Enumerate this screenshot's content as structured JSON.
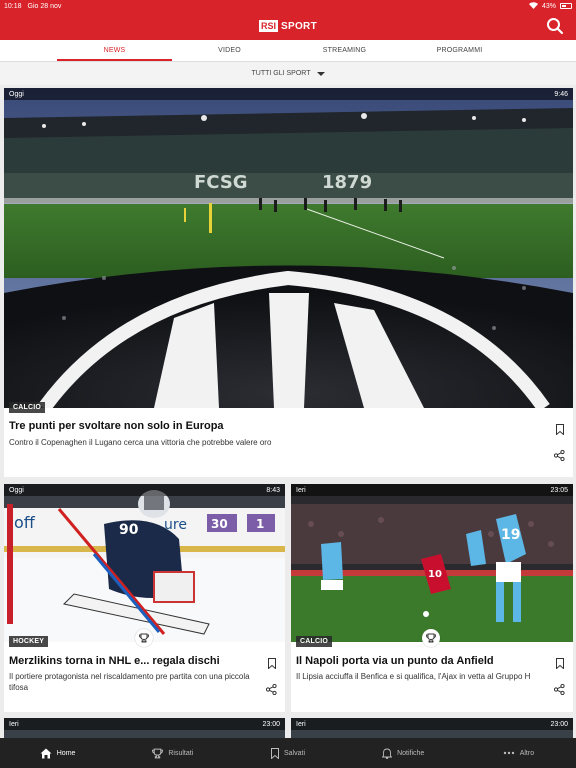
{
  "status": {
    "time": "10:18",
    "date": "Gio 28 nov",
    "battery": "43%"
  },
  "app": {
    "logo_rsi": "RSI",
    "logo_sport": "SPORT"
  },
  "tabs": [
    {
      "label": "NEWS"
    },
    {
      "label": "VIDEO"
    },
    {
      "label": "STREAMING"
    },
    {
      "label": "PROGRAMMI"
    }
  ],
  "filter": {
    "label": "TUTTI GLI SPORT"
  },
  "featured": {
    "day": "Oggi",
    "time": "9:46",
    "category": "CALCIO",
    "title": "Tre punti per svoltare non solo in Europa",
    "description": "Contro il Copenaghen il Lugano cerca una vittoria che potrebbe valere oro",
    "stadium_text": "1879"
  },
  "cards": [
    {
      "day": "Oggi",
      "time": "8:43",
      "category": "HOCKEY",
      "title": "Merzlikins torna in NHL e... regala dischi",
      "description": "Il portiere protagonista nel riscaldamento pre partita con una piccola tifosa",
      "jersey": "90",
      "board1": "30",
      "board2": "1"
    },
    {
      "day": "Ieri",
      "time": "23:05",
      "category": "CALCIO",
      "title": "Il Napoli porta via un punto da Anfield",
      "description": "Il Lipsia acciuffa il Benfica e si qualifica, l'Ajax in vetta al Gruppo H",
      "jersey": "19",
      "jersey2": "10"
    }
  ],
  "next_cards": [
    {
      "day": "Ieri",
      "time": "23:00"
    },
    {
      "day": "Ieri",
      "time": "23:00"
    }
  ],
  "bottom_nav": [
    {
      "label": "Home",
      "icon": "home-icon"
    },
    {
      "label": "Risultati",
      "icon": "trophy-icon"
    },
    {
      "label": "Salvati",
      "icon": "bookmark-icon"
    },
    {
      "label": "Notifiche",
      "icon": "bell-icon"
    },
    {
      "label": "Altro",
      "icon": "more-icon"
    }
  ],
  "colors": {
    "accent": "#d8232a",
    "dark": "#222222"
  }
}
